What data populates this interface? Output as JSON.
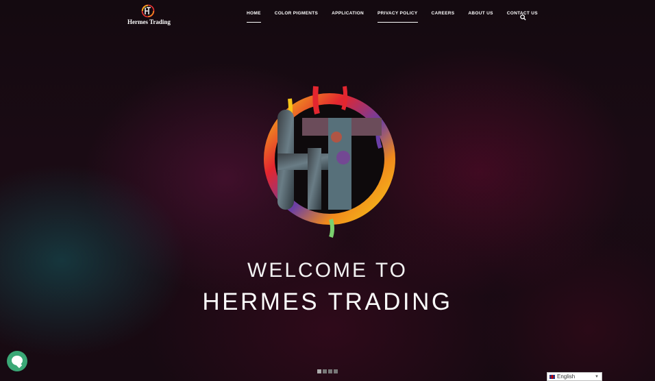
{
  "header": {
    "logo_text": "Hermes Trading",
    "nav": [
      {
        "label": "HOME",
        "active": true
      },
      {
        "label": "COLOR PIGMENTS",
        "active": false
      },
      {
        "label": "APPLICATION",
        "active": false
      },
      {
        "label": "PRIVACY POLICY",
        "active": true
      },
      {
        "label": "CAREERS",
        "active": false
      },
      {
        "label": "ABOUT US",
        "active": false
      },
      {
        "label": "CONTACT US",
        "active": false
      }
    ],
    "search_icon": "search-icon"
  },
  "hero": {
    "logo_letters": "HT",
    "welcome": "WELCOME TO",
    "brand": "HERMES TRADING",
    "slides": 4,
    "active_slide": 1
  },
  "language": {
    "selected": "English"
  },
  "colors": {
    "accent_chat": "#3aa876"
  }
}
